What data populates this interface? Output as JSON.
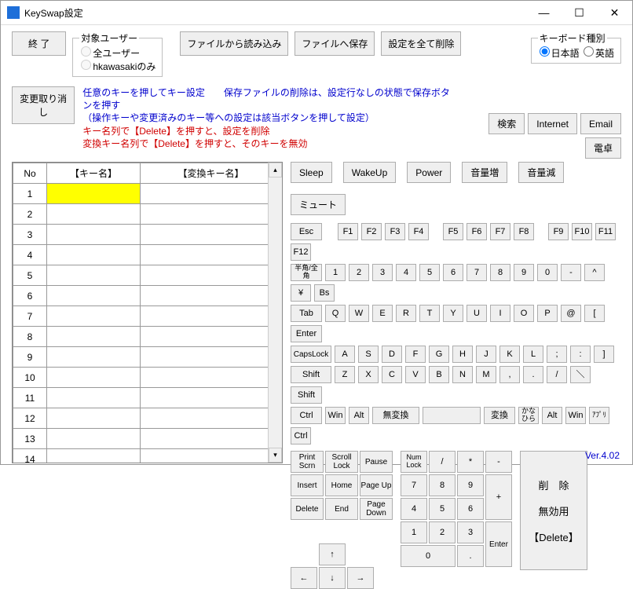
{
  "window": {
    "title": "KeySwap設定"
  },
  "buttons": {
    "exit": "終 了",
    "undo": "変更取り消し",
    "loadFile": "ファイルから読み込み",
    "saveFile": "ファイルへ保存",
    "clearAll": "設定を全て削除"
  },
  "userGroup": {
    "legend": "対象ユーザー",
    "all": "全ユーザー",
    "current": "hkawasakiのみ"
  },
  "kbType": {
    "legend": "キーボード種別",
    "jp": "日本語",
    "en": "英語"
  },
  "help": {
    "l1": "任意のキーを押してキー設定　　保存ファイルの削除は、設定行なしの状態で保存ボタンを押す",
    "l2": "（操作キーや変更済みのキー等への設定は該当ボタンを押して設定）",
    "l3": "キー名列で【Delete】を押すと、設定を削除",
    "l4": "変換キー名列で【Delete】を押すと、そのキーを無効"
  },
  "table": {
    "hNo": "No",
    "hKey": "【キー名】",
    "hConv": "【変換キー名】",
    "rows": 15
  },
  "media": {
    "search": "検索",
    "internet": "Internet",
    "email": "Email",
    "calc": "電卓",
    "sleep": "Sleep",
    "wakeup": "WakeUp",
    "power": "Power",
    "volUp": "音量増",
    "volDown": "音量減",
    "mute": "ミュート"
  },
  "keys": {
    "esc": "Esc",
    "f1": "F1",
    "f2": "F2",
    "f3": "F3",
    "f4": "F4",
    "f5": "F5",
    "f6": "F6",
    "f7": "F7",
    "f8": "F8",
    "f9": "F9",
    "f10": "F10",
    "f11": "F11",
    "f12": "F12",
    "hankaku": "半角/全角",
    "1": "1",
    "2": "2",
    "3": "3",
    "4": "4",
    "5": "5",
    "6": "6",
    "7": "7",
    "8": "8",
    "9": "9",
    "0": "0",
    "minus": "-",
    "caret": "^",
    "yen": "¥",
    "bs": "Bs",
    "tab": "Tab",
    "q": "Q",
    "w": "W",
    "e": "E",
    "r": "R",
    "t": "T",
    "y": "Y",
    "u": "U",
    "i": "I",
    "o": "O",
    "p": "P",
    "at": "@",
    "lbr": "[",
    "enter": "Enter",
    "caps": "CapsLock",
    "a": "A",
    "s": "S",
    "d": "D",
    "f": "F",
    "g": "G",
    "h": "H",
    "j": "J",
    "k": "K",
    "l": "L",
    "semi": ";",
    "colon": ":",
    "rbr": "]",
    "lshift": "Shift",
    "z": "Z",
    "x": "X",
    "c": "C",
    "v": "V",
    "b": "B",
    "n": "N",
    "m": "M",
    "comma": ",",
    "period": ".",
    "slash": "/",
    "bslash": "＼",
    "rshift": "Shift",
    "lctrl": "Ctrl",
    "lwin": "Win",
    "lalt": "Alt",
    "muhenkan": "無変換",
    "henkan": "変換",
    "kana": "かなひら",
    "ralt": "Alt",
    "rwin": "Win",
    "app": "ｱﾌﾟﾘ",
    "rctrl": "Ctrl",
    "prtsc": "Print Scrn",
    "scrlk": "Scroll Lock",
    "pause": "Pause",
    "ins": "Insert",
    "home": "Home",
    "pgup": "Page Up",
    "del": "Delete",
    "end": "End",
    "pgdn": "Page Down",
    "up": "↑",
    "down": "↓",
    "left": "←",
    "right": "→",
    "numlk": "Num Lock",
    "ndiv": "/",
    "nmul": "*",
    "nsub": "-",
    "n7": "7",
    "n8": "8",
    "n9": "9",
    "nadd": "+",
    "n4": "4",
    "n5": "5",
    "n6": "6",
    "n1": "1",
    "n2": "2",
    "n3": "3",
    "nent": "Enter",
    "n0": "0",
    "ndot": "."
  },
  "delbox": {
    "l1": "削　除",
    "l2": "無効用",
    "l3": "【Delete】"
  },
  "version": "Ver.4.02"
}
